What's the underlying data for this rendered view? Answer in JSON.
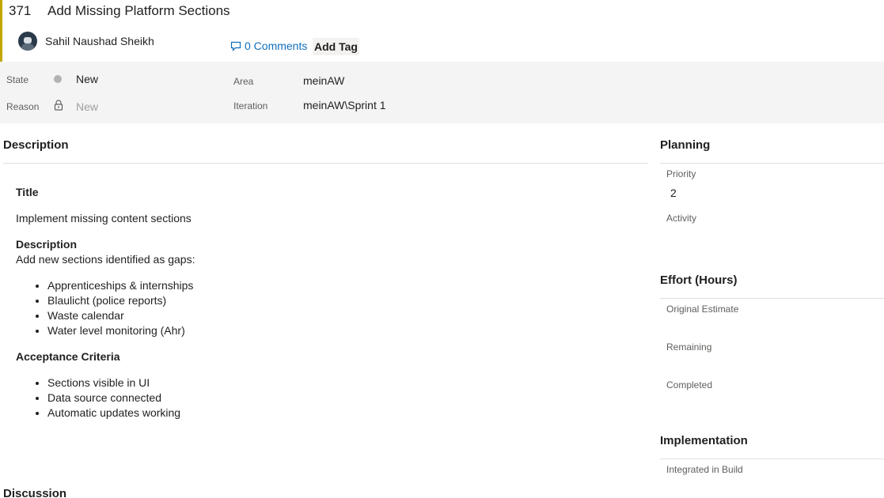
{
  "header": {
    "id": "371",
    "title": "Add Missing Platform Sections",
    "author": "Sahil Naushad Sheikh",
    "comments_label": "0 Comments",
    "add_tag_label": "Add Tag"
  },
  "fields": {
    "state_label": "State",
    "state_value": "New",
    "reason_label": "Reason",
    "reason_value": "New",
    "area_label": "Area",
    "area_value": "meinAW",
    "iteration_label": "Iteration",
    "iteration_value": "meinAW\\Sprint 1"
  },
  "description": {
    "section_title": "Description",
    "title_heading": "Title",
    "title_text": "Implement missing content sections",
    "desc_heading": "Description",
    "desc_intro": "Add new sections identified as gaps:",
    "gaps": [
      "Apprenticeships & internships",
      "Blaulicht (police reports)",
      "Waste calendar",
      "Water level monitoring (Ahr)"
    ],
    "criteria_heading": "Acceptance Criteria",
    "criteria": [
      "Sections visible in UI",
      "Data source connected",
      "Automatic updates working"
    ]
  },
  "discussion": {
    "section_title": "Discussion"
  },
  "planning": {
    "section_title": "Planning",
    "priority_label": "Priority",
    "priority_value": "2",
    "activity_label": "Activity"
  },
  "effort": {
    "section_title": "Effort (Hours)",
    "original_label": "Original Estimate",
    "remaining_label": "Remaining",
    "completed_label": "Completed"
  },
  "implementation": {
    "section_title": "Implementation",
    "build_label": "Integrated in Build"
  },
  "colors": {
    "accent_bar": "#c2a700",
    "link": "#106ebe",
    "field_bg": "#f4f4f4"
  }
}
